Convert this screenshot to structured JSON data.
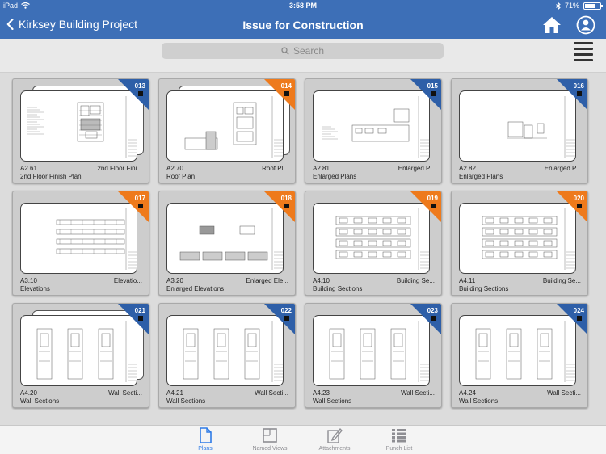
{
  "status_bar": {
    "device": "iPad",
    "time": "3:58 PM",
    "battery": "71%",
    "battery_level": 0.71
  },
  "nav": {
    "back_label": "Kirksey Building Project",
    "title": "Issue for Construction"
  },
  "search": {
    "placeholder": "Search"
  },
  "sheets": [
    {
      "number": "013",
      "badge": "blue",
      "code": "A2.61",
      "short_title": "2nd Floor Fini...",
      "name": "2nd Floor Finish Plan",
      "art": "finish",
      "stacked": true
    },
    {
      "number": "014",
      "badge": "orange",
      "code": "A2.70",
      "short_title": "Roof Pl...",
      "name": "Roof Plan",
      "art": "roof",
      "stacked": true
    },
    {
      "number": "015",
      "badge": "blue",
      "code": "A2.81",
      "short_title": "Enlarged P...",
      "name": "Enlarged Plans",
      "art": "enlarged",
      "stacked": false
    },
    {
      "number": "016",
      "badge": "blue",
      "code": "A2.82",
      "short_title": "Enlarged P...",
      "name": "Enlarged Plans",
      "art": "sparse",
      "stacked": false
    },
    {
      "number": "017",
      "badge": "orange",
      "code": "A3.10",
      "short_title": "Elevatio...",
      "name": "Elevations",
      "art": "elev",
      "stacked": false
    },
    {
      "number": "018",
      "badge": "orange",
      "code": "A3.20",
      "short_title": "Enlarged Ele...",
      "name": "Enlarged Elevations",
      "art": "elev2",
      "stacked": false
    },
    {
      "number": "019",
      "badge": "orange",
      "code": "A4.10",
      "short_title": "Building Se...",
      "name": "Building Sections",
      "art": "section",
      "stacked": false
    },
    {
      "number": "020",
      "badge": "orange",
      "code": "A4.11",
      "short_title": "Building Se...",
      "name": "Building Sections",
      "art": "section2",
      "stacked": false
    },
    {
      "number": "021",
      "badge": "blue",
      "code": "A4.20",
      "short_title": "Wall Secti...",
      "name": "Wall Sections",
      "art": "wall",
      "stacked": true
    },
    {
      "number": "022",
      "badge": "blue",
      "code": "A4.21",
      "short_title": "Wall Secti...",
      "name": "Wall Sections",
      "art": "wall",
      "stacked": false
    },
    {
      "number": "023",
      "badge": "blue",
      "code": "A4.23",
      "short_title": "Wall Secti...",
      "name": "Wall Sections",
      "art": "wall3",
      "stacked": false
    },
    {
      "number": "024",
      "badge": "blue",
      "code": "A4.24",
      "short_title": "Wall Secti...",
      "name": "Wall Sections",
      "art": "wall4",
      "stacked": false
    }
  ],
  "tabs": [
    {
      "label": "Plans",
      "icon": "document-icon",
      "active": true
    },
    {
      "label": "Named Views",
      "icon": "frame-icon",
      "active": false
    },
    {
      "label": "Attachments",
      "icon": "paperclip-icon",
      "active": false
    },
    {
      "label": "Punch List",
      "icon": "list-icon",
      "active": false
    }
  ],
  "colors": {
    "brand": "#3d6fb7",
    "badge_blue": "#2e5fa8",
    "badge_orange": "#ee7a1c",
    "tab_active": "#2e7be6"
  }
}
